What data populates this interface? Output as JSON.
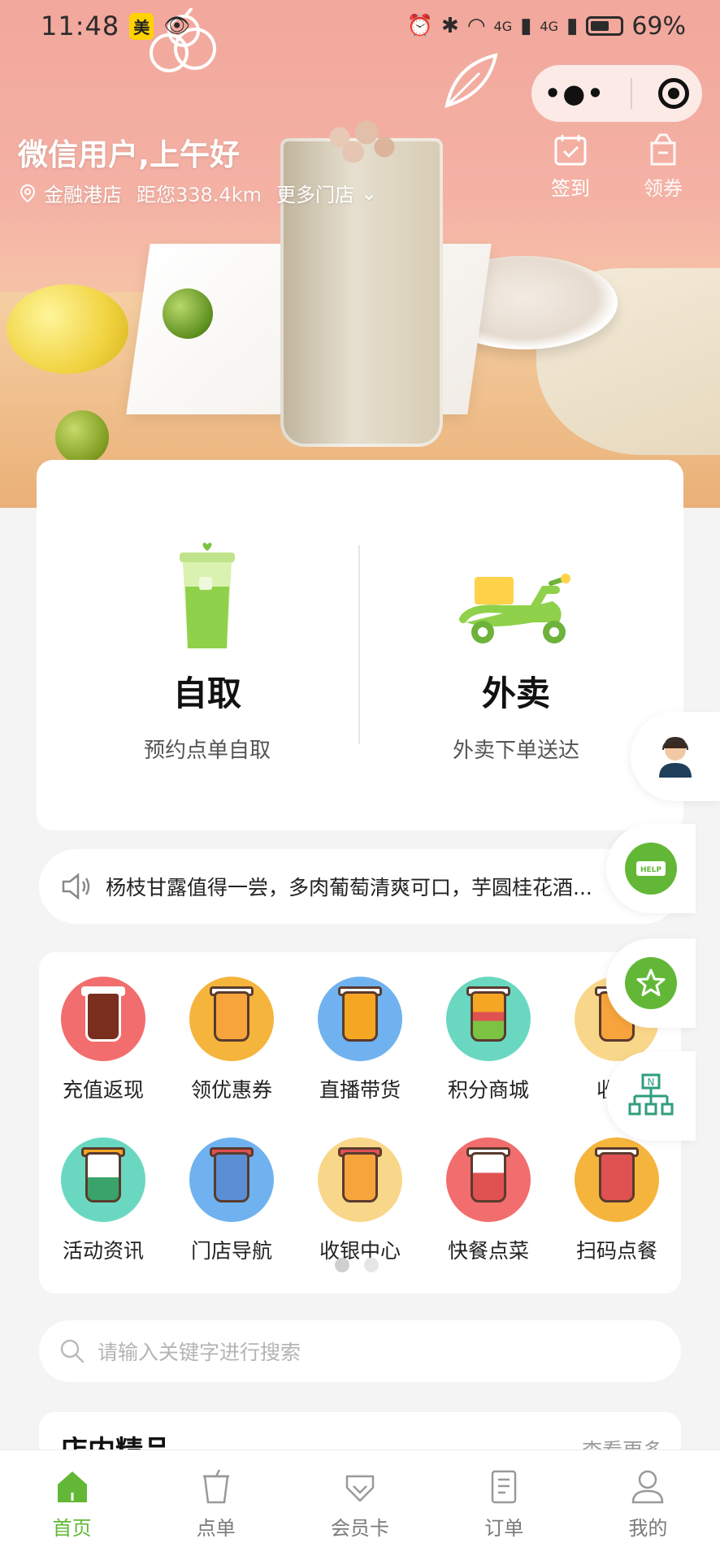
{
  "status_bar": {
    "time": "11:48",
    "badge": "美",
    "battery": "69%",
    "net1": "4G",
    "net2": "4G"
  },
  "header": {
    "greeting": "微信用户,上午好",
    "store_name": "金融港店",
    "distance": "距您338.4km",
    "more_stores": "更多门店",
    "actions": [
      {
        "label": "签到",
        "icon": "calendar-check-icon"
      },
      {
        "label": "领券",
        "icon": "coupon-icon"
      }
    ]
  },
  "order_options": {
    "pickup": {
      "title": "自取",
      "subtitle": "预约点单自取"
    },
    "delivery": {
      "title": "外卖",
      "subtitle": "外卖下单送达"
    }
  },
  "notice": {
    "text": "杨枝甘露值得一尝，多肉葡萄清爽可口，芋圆桂花酒..."
  },
  "grid": {
    "items": [
      {
        "label": "充值返现",
        "color": "#f26d6d",
        "cup": "#c0392b"
      },
      {
        "label": "领优惠券",
        "color": "#f5b43c",
        "cup": "#e07b1a"
      },
      {
        "label": "直播带货",
        "color": "#6fb2ef",
        "cup": "#f5a623"
      },
      {
        "label": "积分商城",
        "color": "#6ad8c1",
        "cup": "#e05252"
      },
      {
        "label": "收藏",
        "color": "#f9d78a",
        "cup": "#e07b1a"
      },
      {
        "label": "活动资讯",
        "color": "#6ad8c1",
        "cup": "#f5a623"
      },
      {
        "label": "门店导航",
        "color": "#6fb2ef",
        "cup": "#e05252"
      },
      {
        "label": "收银中心",
        "color": "#f9d78a",
        "cup": "#e05252"
      },
      {
        "label": "快餐点菜",
        "color": "#f26d6d",
        "cup": "#ffffff"
      },
      {
        "label": "扫码点餐",
        "color": "#f5b43c",
        "cup": "#e05252"
      }
    ]
  },
  "search": {
    "placeholder": "请输入关键字进行搜索"
  },
  "products": {
    "title": "店内精品",
    "more": "查看更多"
  },
  "tabs": [
    {
      "label": "首页",
      "active": true
    },
    {
      "label": "点单",
      "active": false
    },
    {
      "label": "会员卡",
      "active": false
    },
    {
      "label": "订单",
      "active": false
    },
    {
      "label": "我的",
      "active": false
    }
  ],
  "colors": {
    "accent": "#62b836",
    "hero_pink": "#f2a79c",
    "page_bg": "#f4f4f4"
  }
}
